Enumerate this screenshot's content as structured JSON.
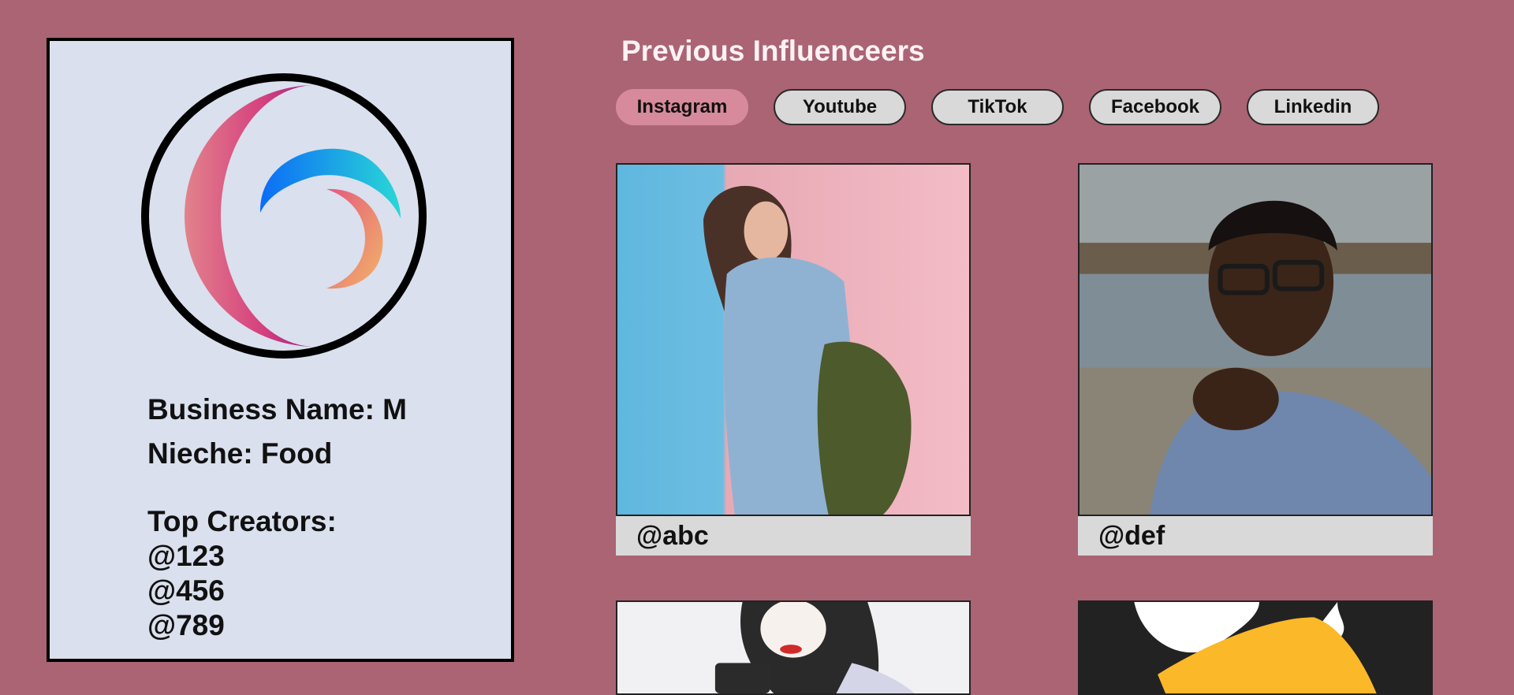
{
  "profile": {
    "business_line": "Business Name: M",
    "niche_line": "Nieche: Food",
    "top_creators_heading": "Top Creators:",
    "creators": [
      "@123",
      "@456",
      "@789"
    ]
  },
  "main": {
    "title": "Previous Influenceers",
    "tabs": [
      {
        "label": "Instagram",
        "active": true
      },
      {
        "label": "Youtube",
        "active": false
      },
      {
        "label": "TikTok",
        "active": false
      },
      {
        "label": "Facebook",
        "active": false
      },
      {
        "label": "Linkedin",
        "active": false
      }
    ],
    "cards": [
      {
        "handle": "@abc"
      },
      {
        "handle": "@def"
      }
    ]
  },
  "colors": {
    "background": "#ab6474",
    "panel": "#dae0ed",
    "active_tab": "#d78a9b",
    "tab": "#d9d9d9"
  }
}
